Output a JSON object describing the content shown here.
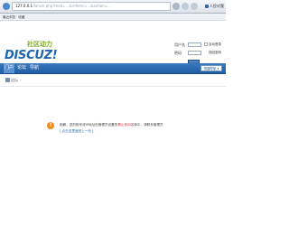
{
  "browser": {
    "url_host": "127.0.0.1",
    "url_rest": "/forum.php?mod=...&referer=...&action=...",
    "extension_label": "人民对我",
    "bookmark_label": "最近浏览 · 收藏"
  },
  "header": {
    "logo_cn": "社区动力",
    "logo_en": "DISCUZ!"
  },
  "login": {
    "username_label": "用户名",
    "password_label": "密码",
    "remember_label": "自动登录",
    "forgot_label": "找回密码"
  },
  "nav": {
    "items": [
      {
        "label": "门户"
      },
      {
        "label": "论坛"
      },
      {
        "label": "导航"
      }
    ],
    "quick_nav_label": "快捷导航 ▾"
  },
  "breadcrumb": {
    "home_label": "论坛",
    "chevron": "›"
  },
  "message": {
    "icon_glyph": "!",
    "line1_pre": "抱歉，您的账号或IP地址在管理员设置的",
    "line1_highlight": "禁止访问",
    "line1_post": "名单中，请联系管理员",
    "line2": "[ 点击这里返回上一页 ]"
  },
  "colors": {
    "brand_blue": "#1f66b1",
    "nav_blue": "#2c6bb3",
    "warning_orange": "#f28a1a",
    "error_red": "#d0120f"
  }
}
